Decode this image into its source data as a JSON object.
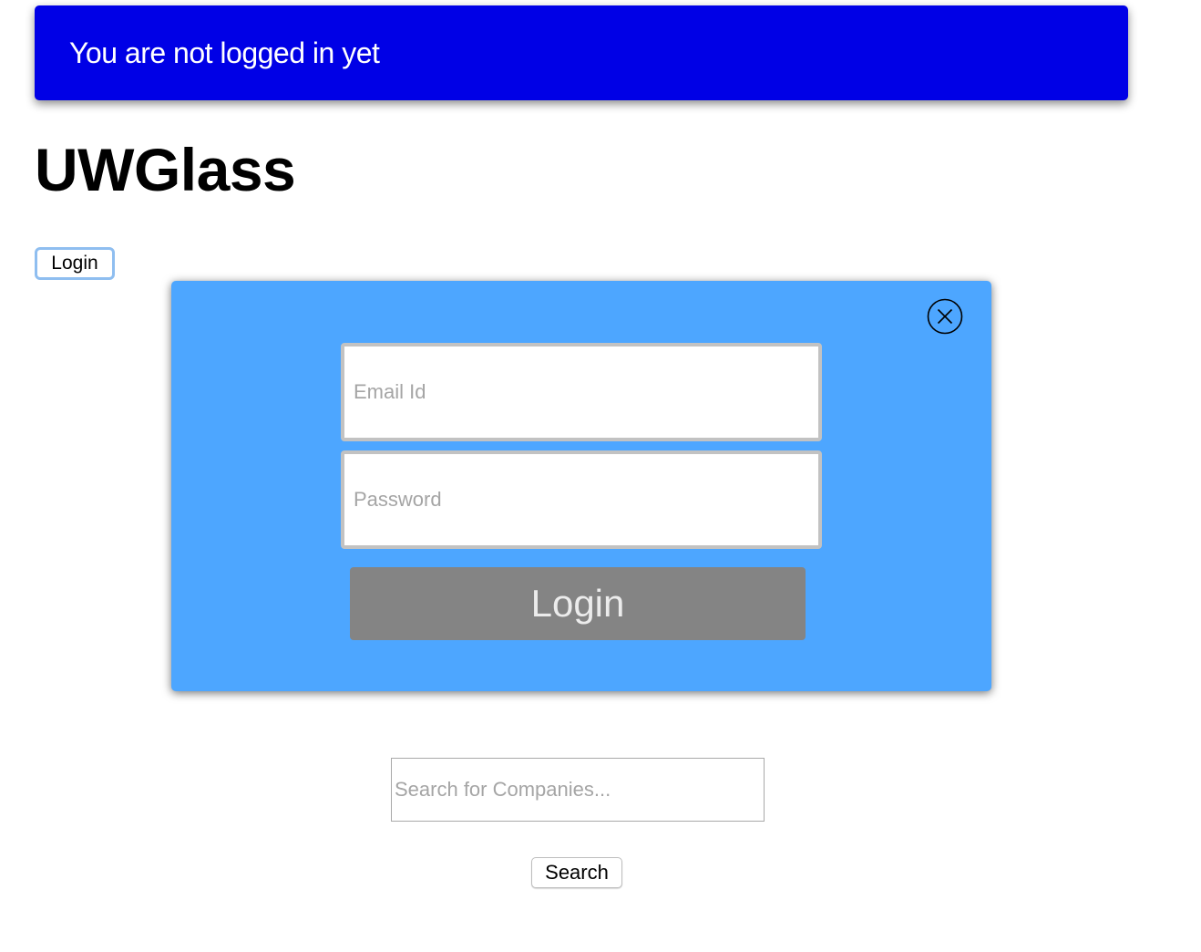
{
  "banner": {
    "message": "You are not logged in yet",
    "background_color": "#0000e6",
    "text_color": "#ffffff"
  },
  "site": {
    "title": "UWGlass"
  },
  "header": {
    "login_label": "Login"
  },
  "login_modal": {
    "background_color": "#4da6ff",
    "close_icon": "close-circle-icon",
    "email_placeholder": "Email Id",
    "email_value": "",
    "password_placeholder": "Password",
    "password_value": "",
    "submit_label": "Login",
    "submit_color": "#848484"
  },
  "search": {
    "placeholder": "Search for Companies...",
    "value": "",
    "button_label": "Search"
  }
}
